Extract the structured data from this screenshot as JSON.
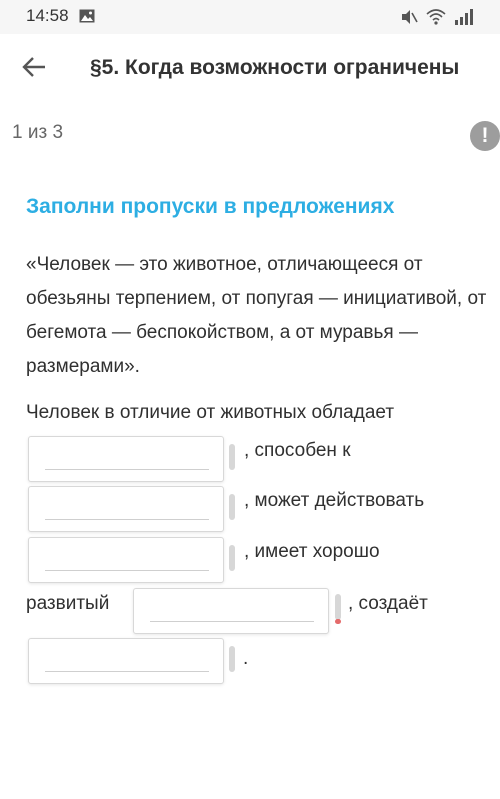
{
  "status_bar": {
    "time": "14:58",
    "icons": [
      "gallery-icon",
      "mute-icon",
      "wifi-icon",
      "signal-icon"
    ]
  },
  "header": {
    "back_icon": "arrow-left-icon",
    "title": "§5. Когда возможности ограничены"
  },
  "progress": {
    "text": "1 из 3",
    "report_glyph": "!"
  },
  "task": {
    "heading": "Заполни пропуски в предложениях",
    "quote": "«Человек — это животное, отличающееся от обезьяны терпением, от попугая — инициативой, от бегемота — беспокойством, а от муравья — размерами».",
    "sentence_intro": "Человек в отличие от животных обладает",
    "after_blank_1": ", способен к",
    "after_blank_2": ", может действовать",
    "after_blank_3": ", имеет хорошо",
    "before_blank_4": "развитый",
    "after_blank_4": ", создаёт",
    "after_blank_5": ".",
    "blanks": [
      {
        "value": "",
        "placeholder": ""
      },
      {
        "value": "",
        "placeholder": ""
      },
      {
        "value": "",
        "placeholder": ""
      },
      {
        "value": "",
        "placeholder": ""
      },
      {
        "value": "",
        "placeholder": ""
      }
    ]
  },
  "colors": {
    "accent": "#2daee3",
    "report_badge": "#9d9d9d",
    "warning": "#e46a6a"
  }
}
